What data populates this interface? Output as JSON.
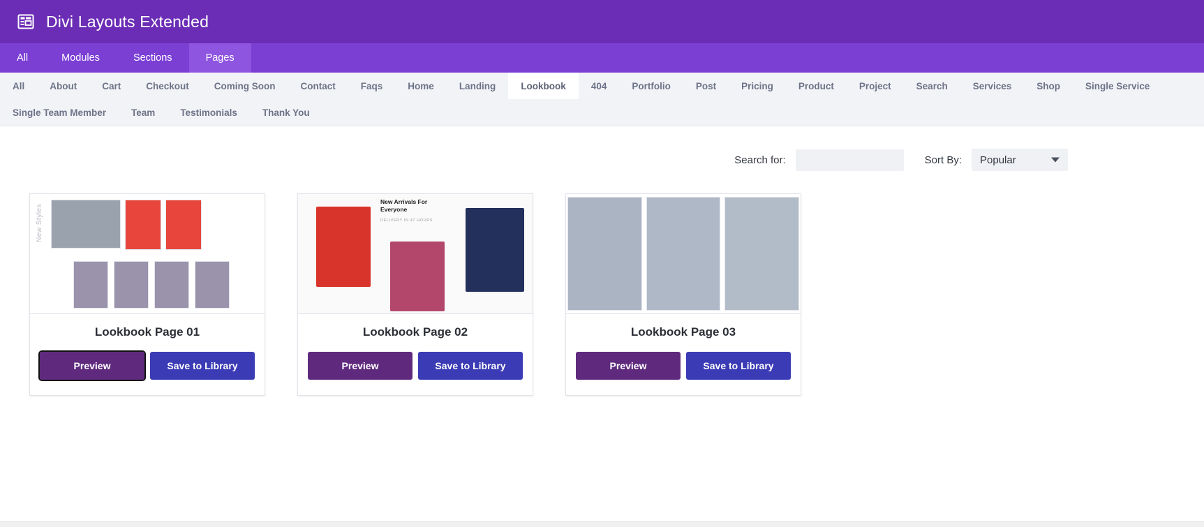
{
  "header": {
    "title": "Divi Layouts Extended",
    "icon": "layout-grid-icon"
  },
  "main_tabs": [
    {
      "label": "All",
      "active": false
    },
    {
      "label": "Modules",
      "active": false
    },
    {
      "label": "Sections",
      "active": false
    },
    {
      "label": "Pages",
      "active": true
    }
  ],
  "subnav_row1": [
    {
      "label": "All",
      "active": false
    },
    {
      "label": "About",
      "active": false
    },
    {
      "label": "Cart",
      "active": false
    },
    {
      "label": "Checkout",
      "active": false
    },
    {
      "label": "Coming Soon",
      "active": false
    },
    {
      "label": "Contact",
      "active": false
    },
    {
      "label": "Faqs",
      "active": false
    },
    {
      "label": "Home",
      "active": false
    },
    {
      "label": "Landing",
      "active": false
    },
    {
      "label": "Lookbook",
      "active": true
    },
    {
      "label": "404",
      "active": false
    },
    {
      "label": "Portfolio",
      "active": false
    },
    {
      "label": "Post",
      "active": false
    },
    {
      "label": "Pricing",
      "active": false
    },
    {
      "label": "Product",
      "active": false
    },
    {
      "label": "Project",
      "active": false
    },
    {
      "label": "Search",
      "active": false
    },
    {
      "label": "Services",
      "active": false
    },
    {
      "label": "Shop",
      "active": false
    },
    {
      "label": "Single Service",
      "active": false
    }
  ],
  "subnav_row2": [
    {
      "label": "Single Team Member",
      "active": false
    },
    {
      "label": "Team",
      "active": false
    },
    {
      "label": "Testimonials",
      "active": false
    },
    {
      "label": "Thank You",
      "active": false
    }
  ],
  "toolbar": {
    "search_label": "Search for:",
    "search_value": "",
    "search_placeholder": "",
    "sort_label": "Sort By:",
    "sort_value": "Popular",
    "sort_options": [
      "Popular"
    ],
    "dropdown_icon": "chevron-down-icon"
  },
  "cards": [
    {
      "title": "Lookbook Page 01",
      "preview_label": "Preview",
      "save_label": "Save to Library",
      "focused": true,
      "thumb_caption": "New Styles"
    },
    {
      "title": "Lookbook Page 02",
      "preview_label": "Preview",
      "save_label": "Save to Library",
      "focused": false,
      "thumb_heading": "New Arrivals For Everyone",
      "thumb_sub": "DELIVERY IN 47 HOURS"
    },
    {
      "title": "Lookbook Page 03",
      "preview_label": "Preview",
      "save_label": "Save to Library",
      "focused": false
    }
  ],
  "colors": {
    "header_purple": "#6B2DB5",
    "tabbar_purple": "#7B3FD4",
    "tab_active_purple": "#8E55E0",
    "subnav_bg": "#F2F3F7",
    "preview_button": "#5F2A7E",
    "save_button": "#3B3BB5"
  }
}
